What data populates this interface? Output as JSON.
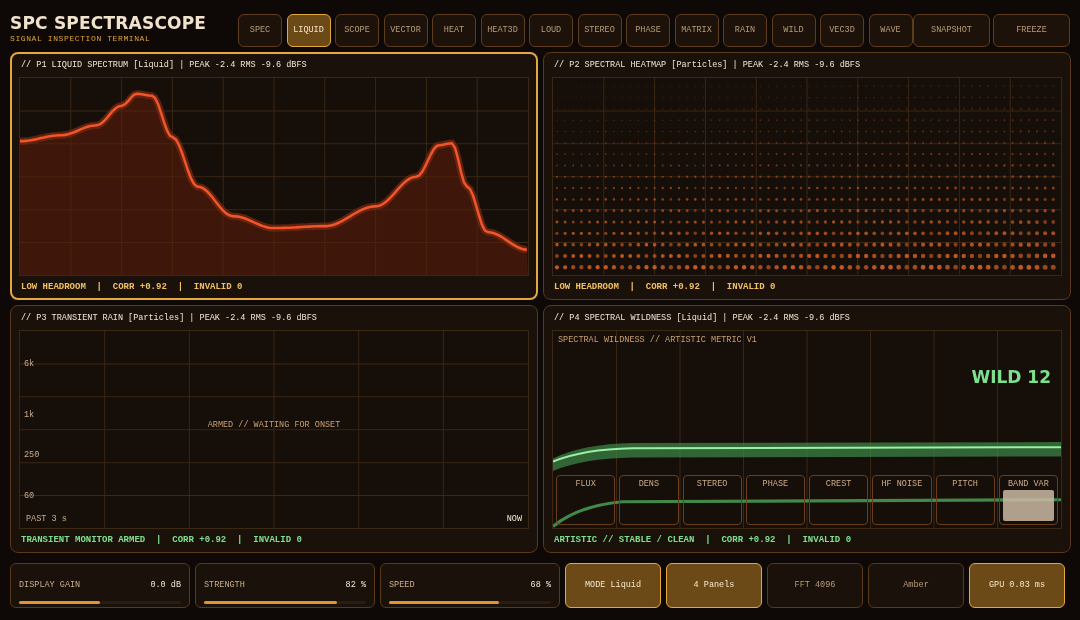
{
  "app": {
    "title": "SPC SPECTRASCOPE",
    "subtitle": "SIGNAL INSPECTION TERMINAL"
  },
  "views": [
    {
      "label": "SPEC",
      "selected": false
    },
    {
      "label": "LIQUID",
      "selected": true
    },
    {
      "label": "SCOPE",
      "selected": false
    },
    {
      "label": "VECTOR",
      "selected": false
    },
    {
      "label": "HEAT",
      "selected": false
    },
    {
      "label": "HEAT3D",
      "selected": false
    },
    {
      "label": "LOUD",
      "selected": false
    },
    {
      "label": "STEREO",
      "selected": false
    },
    {
      "label": "PHASE",
      "selected": false
    },
    {
      "label": "MATRIX",
      "selected": false
    },
    {
      "label": "RAIN",
      "selected": false
    },
    {
      "label": "WILD",
      "selected": false
    },
    {
      "label": "VEC3D",
      "selected": false
    },
    {
      "label": "WAVE",
      "selected": false
    }
  ],
  "actions": [
    "SNAPSHOT",
    "FREEZE"
  ],
  "panels": [
    {
      "kind": "spectrum",
      "title": "// P1 LIQUID SPECTRUM [Liquid] | PEAK -2.4 RMS -9.6 dBFS",
      "selected": true,
      "footer": {
        "text": "LOW HEADROOM  |  CORR +0.92  |  INVALID 0",
        "color": "#f0c060"
      }
    },
    {
      "kind": "heatmap",
      "title": "// P2 SPECTRAL HEATMAP [Particles] | PEAK -2.4 RMS -9.6 dBFS",
      "selected": false,
      "footer": {
        "text": "LOW HEADROOM  |  CORR +0.92  |  INVALID 0",
        "color": "#f0c060"
      }
    },
    {
      "kind": "rain",
      "title": "// P3 TRANSIENT RAIN [Particles] | PEAK -2.4 RMS -9.6 dBFS",
      "selected": false,
      "footer": {
        "text": "TRANSIENT MONITOR ARMED  |  CORR +0.92  |  INVALID 0",
        "color": "#7ee08e"
      },
      "y_labels": [
        "6k",
        "1k",
        "250",
        "60"
      ],
      "message": "ARMED // WAITING FOR ONSET",
      "time_start": "PAST 3 s",
      "time_end": "NOW"
    },
    {
      "kind": "wildness",
      "title": "// P4 SPECTRAL WILDNESS [Liquid] | PEAK -2.4 RMS -9.6 dBFS",
      "selected": false,
      "footer": {
        "text": "ARTISTIC // STABLE / CLEAN  |  CORR +0.92  |  INVALID 0",
        "color": "#7ee08e"
      },
      "subtitle": "SPECTRAL WILDNESS // ARTISTIC METRIC V1",
      "score": "WILD 12",
      "metrics": [
        {
          "label": "FLUX",
          "selected": false
        },
        {
          "label": "DENS",
          "selected": false
        },
        {
          "label": "STEREO",
          "selected": false
        },
        {
          "label": "PHASE",
          "selected": false
        },
        {
          "label": "CREST",
          "selected": false
        },
        {
          "label": "HF NOISE",
          "selected": false
        },
        {
          "label": "PITCH",
          "selected": false
        },
        {
          "label": "BAND VAR",
          "selected": true
        }
      ]
    }
  ],
  "sliders": [
    {
      "label": "DISPLAY GAIN",
      "value": "0.0 dB",
      "level": 0.5
    },
    {
      "label": "STRENGTH",
      "value": "82 %",
      "level": 0.82
    },
    {
      "label": "SPEED",
      "value": "68 %",
      "level": 0.68
    }
  ],
  "chips": [
    {
      "label": "MODE Liquid",
      "on": true
    },
    {
      "label": "4 Panels",
      "on": true
    },
    {
      "label": "FFT 4096",
      "on": false
    },
    {
      "label": "Amber",
      "on": false
    },
    {
      "label": "GPU 0.03 ms",
      "on": true
    }
  ]
}
